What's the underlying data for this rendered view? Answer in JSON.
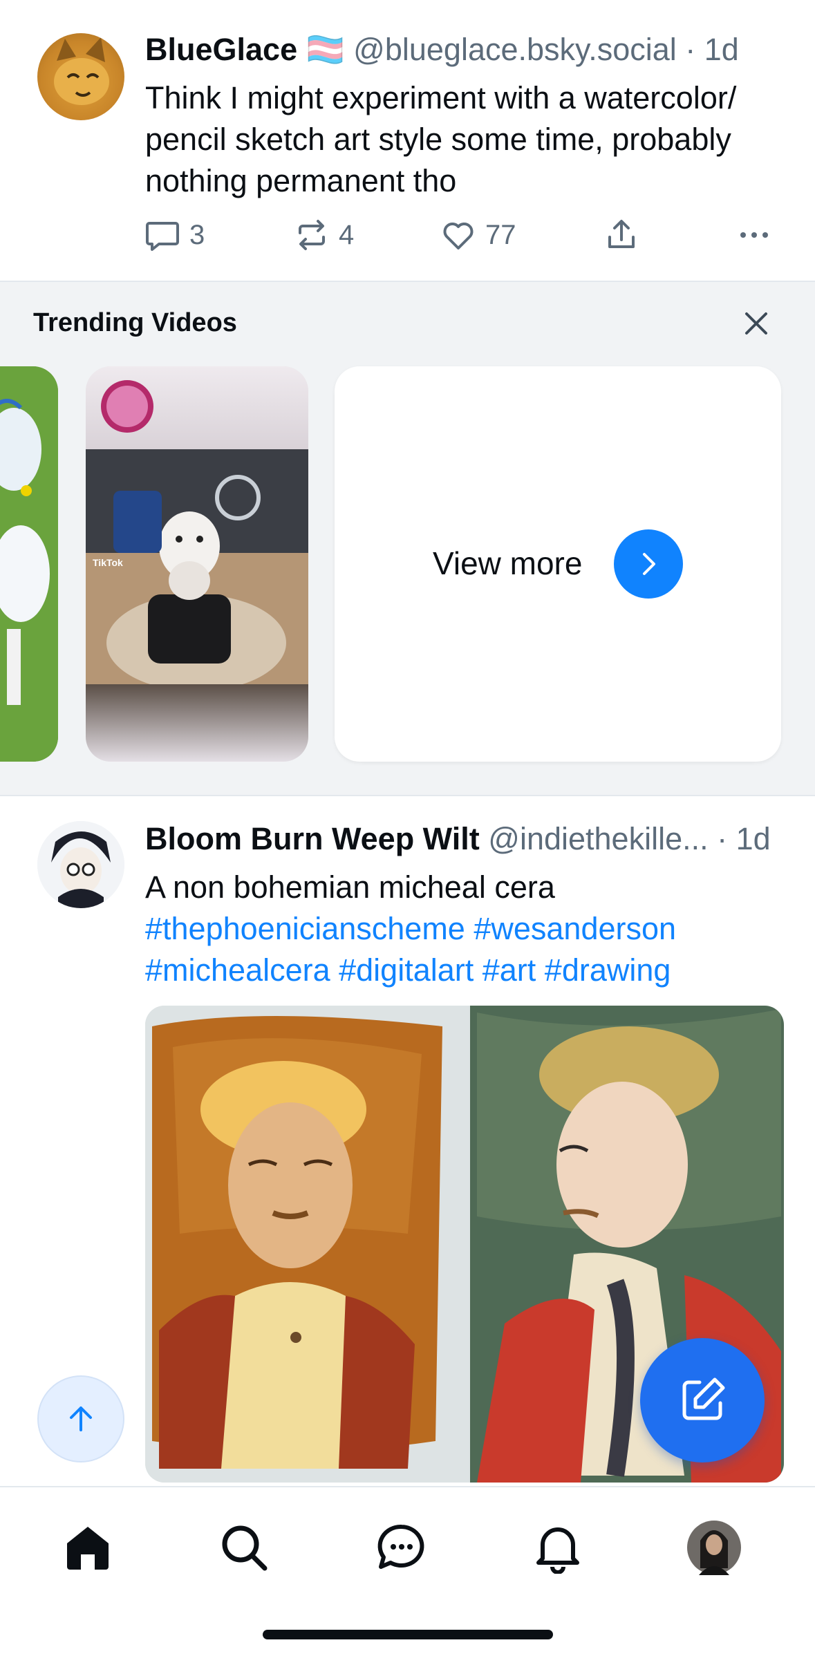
{
  "posts": [
    {
      "author": "BlueGlace",
      "flag": "🏳️‍⚧️",
      "handle": "@blueglace.bsky.social",
      "separator": "·",
      "time": "1d",
      "text": "Think I might experiment with a watercolor/ pencil sketch art style some time, probably nothing permanent tho",
      "replies": "3",
      "reposts": "4",
      "likes": "77"
    },
    {
      "author": "Bloom Burn Weep Wilt",
      "handle": "@indiethekille...",
      "separator": "·",
      "time": "1d",
      "text": "A non bohemian micheal cera",
      "hashtags_line1": "#thephoenicianscheme #wesanderson",
      "hashtags_line2": "#michealcera #digitalart #art #drawing"
    }
  ],
  "trending": {
    "title": "Trending Videos",
    "view_more": "View more",
    "video_watermark": "TikTok"
  },
  "tabs": [
    "home",
    "search",
    "chat",
    "notifications",
    "profile"
  ],
  "colors": {
    "accent": "#1083fe",
    "compose": "#1f6ff0",
    "muted": "#5c6b7a",
    "trending_bg": "#f1f3f5"
  }
}
